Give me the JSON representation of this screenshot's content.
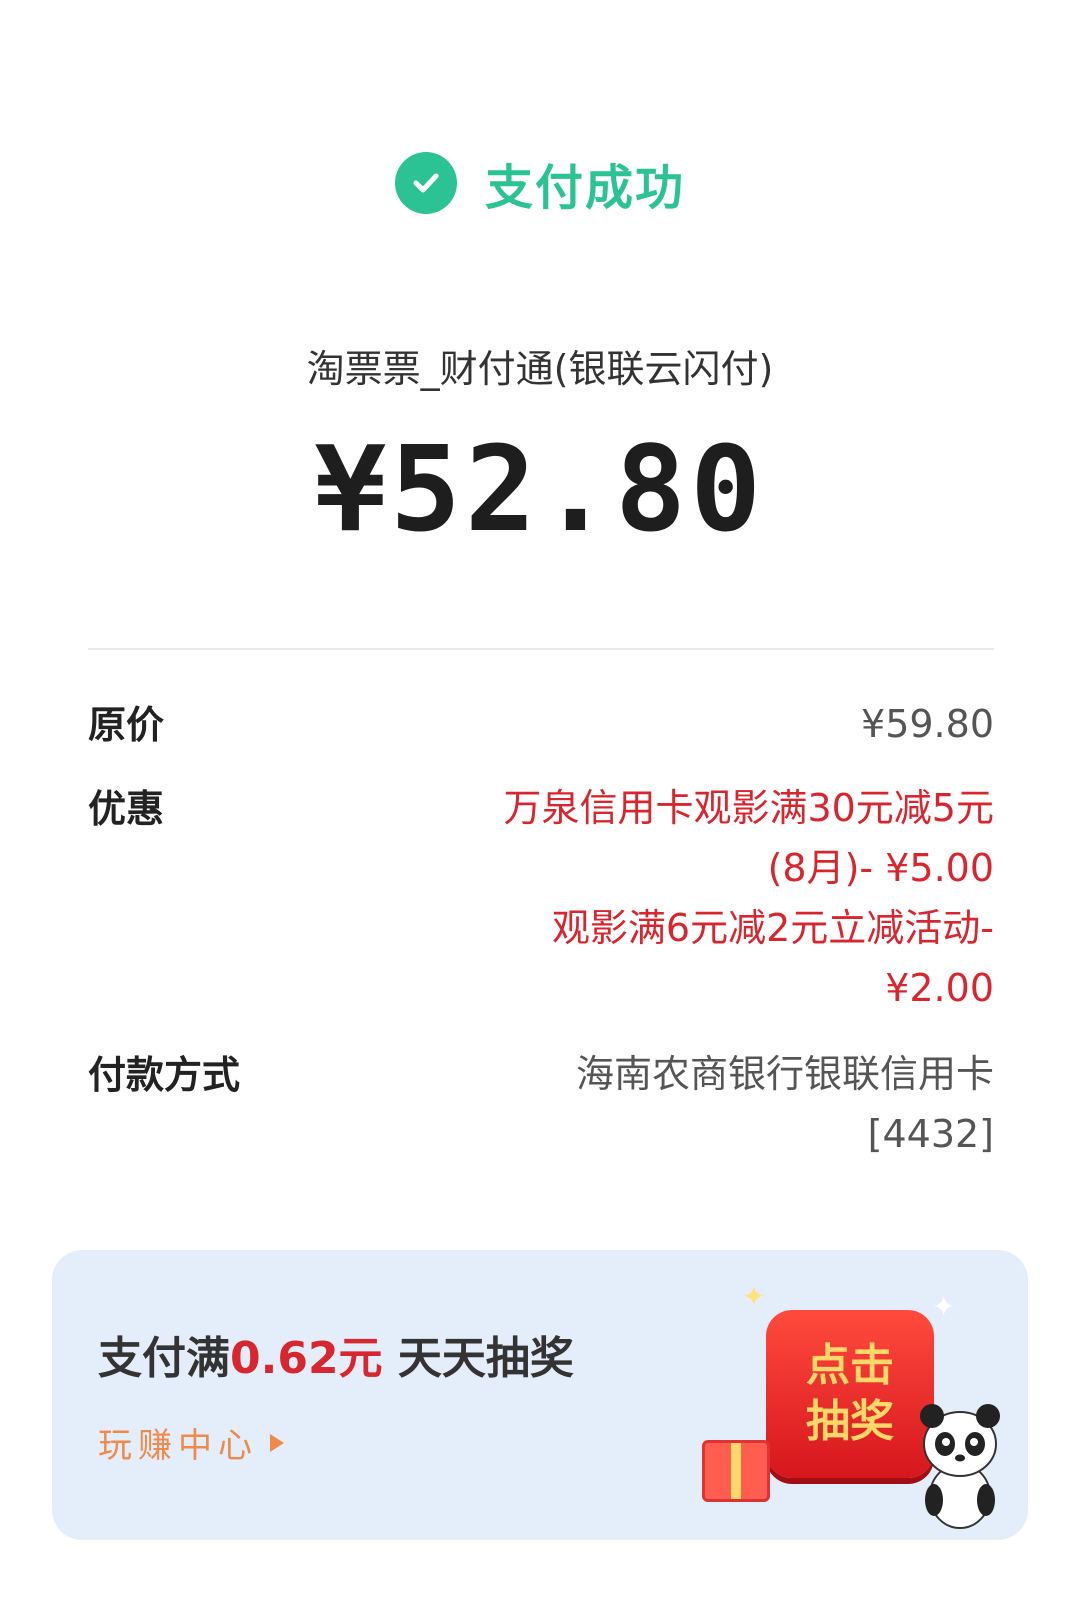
{
  "status": {
    "icon": "check-circle-icon",
    "text": "支付成功",
    "color": "#2cc394"
  },
  "merchant": "淘票票_财付通(银联云闪付)",
  "amount": "¥52.80",
  "details": {
    "original_price_label": "原价",
    "original_price_value": "¥59.80",
    "discount_label": "优惠",
    "discount_lines": [
      "万泉信用卡观影满30元减5元",
      "(8月)- ¥5.00",
      "观影满6元减2元立减活动-",
      "¥2.00"
    ],
    "payment_method_label": "付款方式",
    "payment_method_lines": [
      "海南农商银行银联信用卡",
      "[4432]"
    ]
  },
  "banner": {
    "title_prefix": "支付满",
    "title_amount": "0.62元",
    "title_suffix": " 天天抽奖",
    "sub_link": "玩赚中心",
    "button_line1": "点击",
    "button_line2": "抽奖"
  },
  "colors": {
    "accent_green": "#2cc394",
    "discount_red": "#d7262e",
    "link_orange": "#f08a4b",
    "banner_bg": "#e4eefa"
  }
}
